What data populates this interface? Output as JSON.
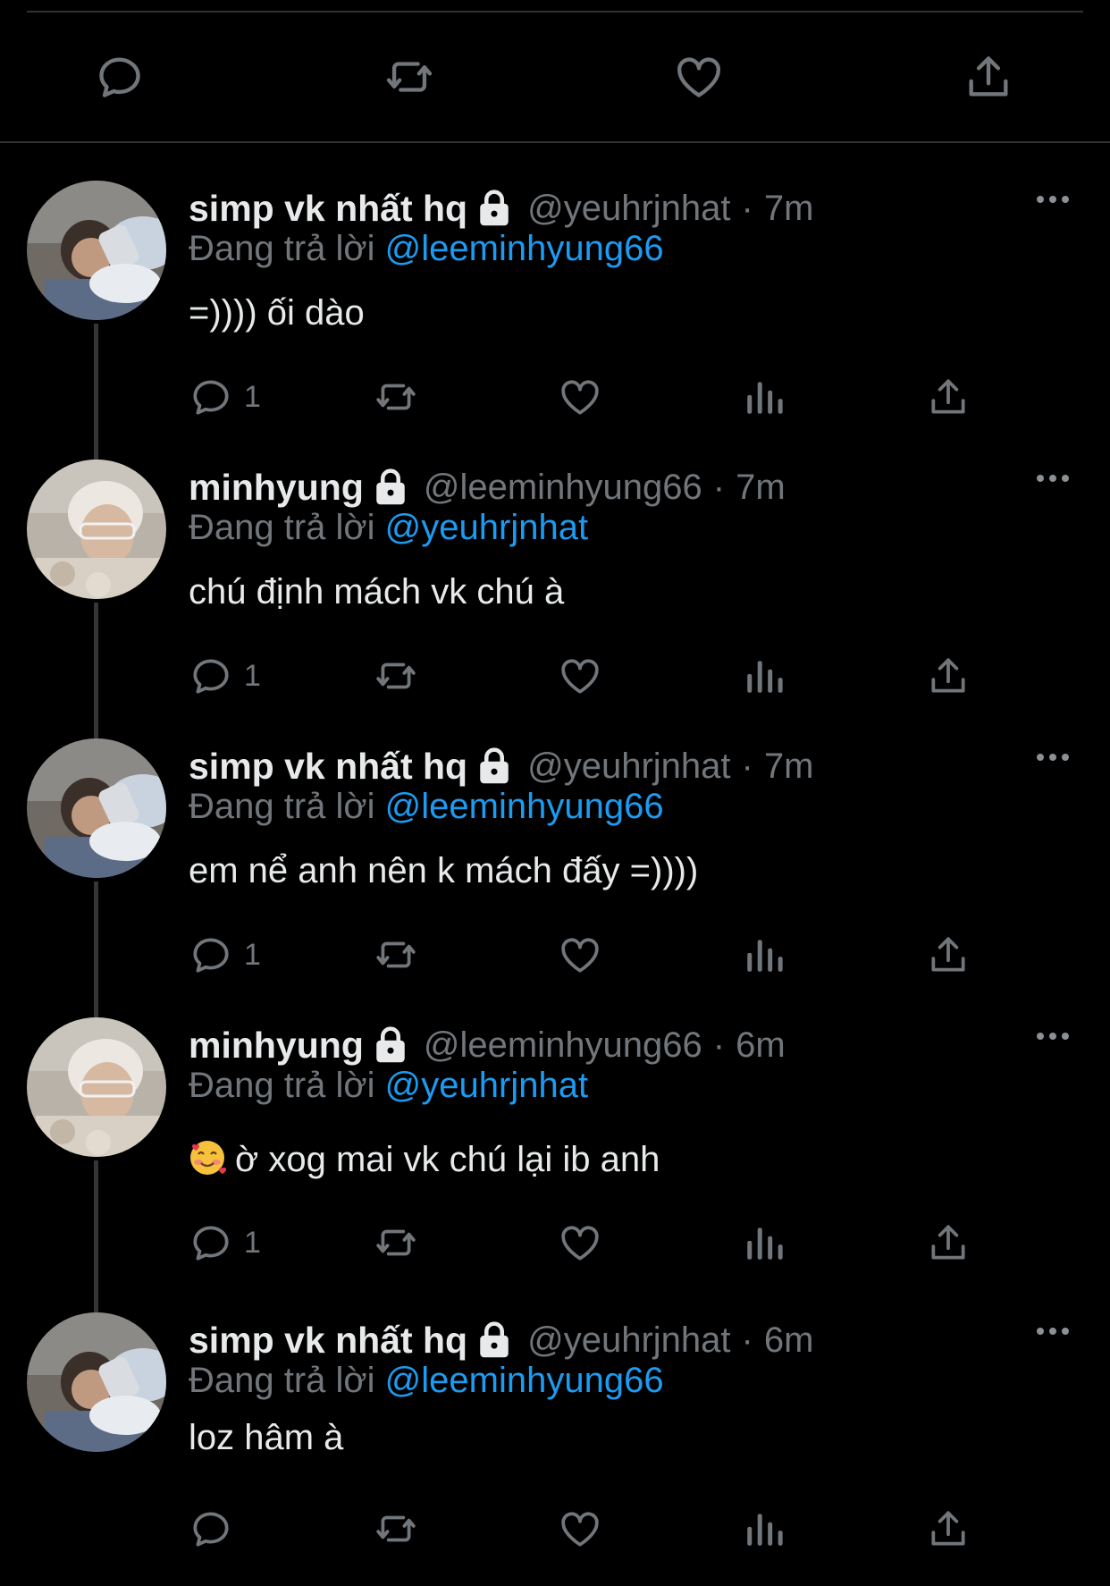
{
  "top_actions": {
    "reply_icon": "reply-icon",
    "retweet_icon": "retweet-icon",
    "like_icon": "heart-icon",
    "share_icon": "share-icon"
  },
  "colors": {
    "background": "#000000",
    "text": "#e7e9ea",
    "muted": "#71767b",
    "accent": "#1d9bf0"
  },
  "tweets": [
    {
      "name": "simp vk nhất hq",
      "handle": "@yeuhrjnhat",
      "dot": "·",
      "time": "7m",
      "reply_prefix": "Đang trả lời",
      "reply_to": "@leeminhyung66",
      "text": "=)))) ối dào",
      "reply_count": "1",
      "avatar": "avatar-user-a"
    },
    {
      "name": "minhyung",
      "handle": "@leeminhyung66",
      "dot": "·",
      "time": "7m",
      "reply_prefix": "Đang trả lời",
      "reply_to": "@yeuhrjnhat",
      "text": "chú định mách vk chú à",
      "reply_count": "1",
      "avatar": "avatar-user-b"
    },
    {
      "name": "simp vk nhất hq",
      "handle": "@yeuhrjnhat",
      "dot": "·",
      "time": "7m",
      "reply_prefix": "Đang trả lời",
      "reply_to": "@leeminhyung66",
      "text": "em nể anh nên k mách đấy =))))",
      "reply_count": "1",
      "avatar": "avatar-user-a"
    },
    {
      "name": "minhyung",
      "handle": "@leeminhyung66",
      "dot": "·",
      "time": "6m",
      "reply_prefix": "Đang trả lời",
      "reply_to": "@yeuhrjnhat",
      "text": "ờ xog mai vk chú lại ib anh",
      "emoji": "smiling-face-with-hearts",
      "reply_count": "1",
      "avatar": "avatar-user-b"
    },
    {
      "name": "simp vk nhất hq",
      "handle": "@yeuhrjnhat",
      "dot": "·",
      "time": "6m",
      "reply_prefix": "Đang trả lời",
      "reply_to": "@leeminhyung66",
      "text": "loz hâm à",
      "reply_count": "",
      "avatar": "avatar-user-a"
    }
  ]
}
